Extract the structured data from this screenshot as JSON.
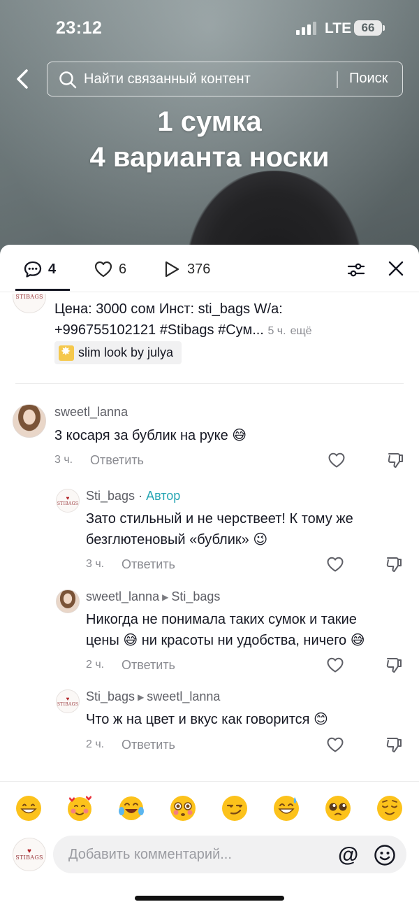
{
  "status_bar": {
    "time": "23:12",
    "network": "LTE",
    "battery": "66"
  },
  "search": {
    "placeholder": "Найти связанный контент",
    "submit_label": "Поиск"
  },
  "video_overlay": {
    "line1": "1 сумка",
    "line2": "4 варианта носки"
  },
  "tabs": {
    "comments_count": "4",
    "likes_count": "6",
    "plays_count": "376"
  },
  "caption": {
    "line1": "Цена: 3000 сом Инст: sti_bags W/a:",
    "line2": "+996755102121 #Stibags #Сум...",
    "time": "5 ч.",
    "more": "ещё",
    "sound": "slim look by julya"
  },
  "avatar_brand_text": "STIBAGS",
  "comments": [
    {
      "user": "sweetl_lanna",
      "text": "3 косаря за бублик на руке 😅",
      "time": "3 ч.",
      "reply_label": "Ответить"
    },
    {
      "user": "Sti_bags",
      "sep": " · ",
      "author_badge": "Автор",
      "text_line1": "Зато стильный и не черствеет! К тому же",
      "text_line2": "безглютеновый «бублик» 😉",
      "time": "3 ч.",
      "reply_label": "Ответить"
    },
    {
      "user": "sweetl_lanna",
      "reply_to": "Sti_bags",
      "text_line1": "Никогда не понимала таких сумок и такие",
      "text_line2": "цены 😅 ни красоты ни удобства, ничего 😅",
      "time": "2 ч.",
      "reply_label": "Ответить"
    },
    {
      "user": "Sti_bags",
      "reply_to": "sweetl_lanna",
      "text": "Что ж на цвет и вкус как говорится 😊",
      "time": "2 ч.",
      "reply_label": "Ответить"
    }
  ],
  "emoji_bar": [
    "😁",
    "🥰",
    "😂",
    "😳",
    "😏",
    "😅",
    "🥺",
    "😌"
  ],
  "comment_input": {
    "placeholder": "Добавить комментарий...",
    "mention_label": "@"
  },
  "colors": {
    "author": "#27a6b4",
    "text": "#161823",
    "muted": "#8a8b91"
  }
}
